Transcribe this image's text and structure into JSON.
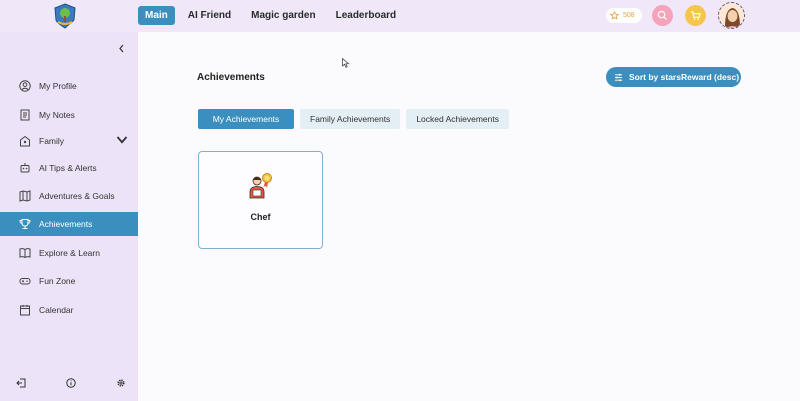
{
  "nav": {
    "items": [
      {
        "label": "Main",
        "active": true
      },
      {
        "label": "AI Friend",
        "active": false
      },
      {
        "label": "Magic garden",
        "active": false
      },
      {
        "label": "Leaderboard",
        "active": false
      }
    ]
  },
  "header": {
    "stars_count": "508"
  },
  "sidebar": {
    "items": [
      {
        "label": "My Profile",
        "icon": "user-icon"
      },
      {
        "label": "My Notes",
        "icon": "notes-icon"
      },
      {
        "label": "Family",
        "icon": "family-icon"
      },
      {
        "label": "AI Tips & Alerts",
        "icon": "robot-icon"
      },
      {
        "label": "Adventures & Goals",
        "icon": "map-icon"
      },
      {
        "label": "Achievements",
        "icon": "trophy-icon"
      },
      {
        "label": "Explore & Learn",
        "icon": "book-icon"
      },
      {
        "label": "Fun Zone",
        "icon": "gamepad-icon"
      },
      {
        "label": "Calendar",
        "icon": "calendar-icon"
      }
    ]
  },
  "main": {
    "title": "Achievements",
    "sort_label": "Sort by starsReward (desc)",
    "tabs": [
      {
        "label": "My Achievements",
        "active": true
      },
      {
        "label": "Family Achievements",
        "active": false
      },
      {
        "label": "Locked Achievements",
        "active": false
      }
    ],
    "cards": [
      {
        "label": "Chef",
        "icon": "chef-award-icon"
      }
    ]
  },
  "colors": {
    "accent": "#3b8fbf",
    "sidebar_bg": "#ede3f8",
    "topbar_bg": "#f0e8f9"
  }
}
